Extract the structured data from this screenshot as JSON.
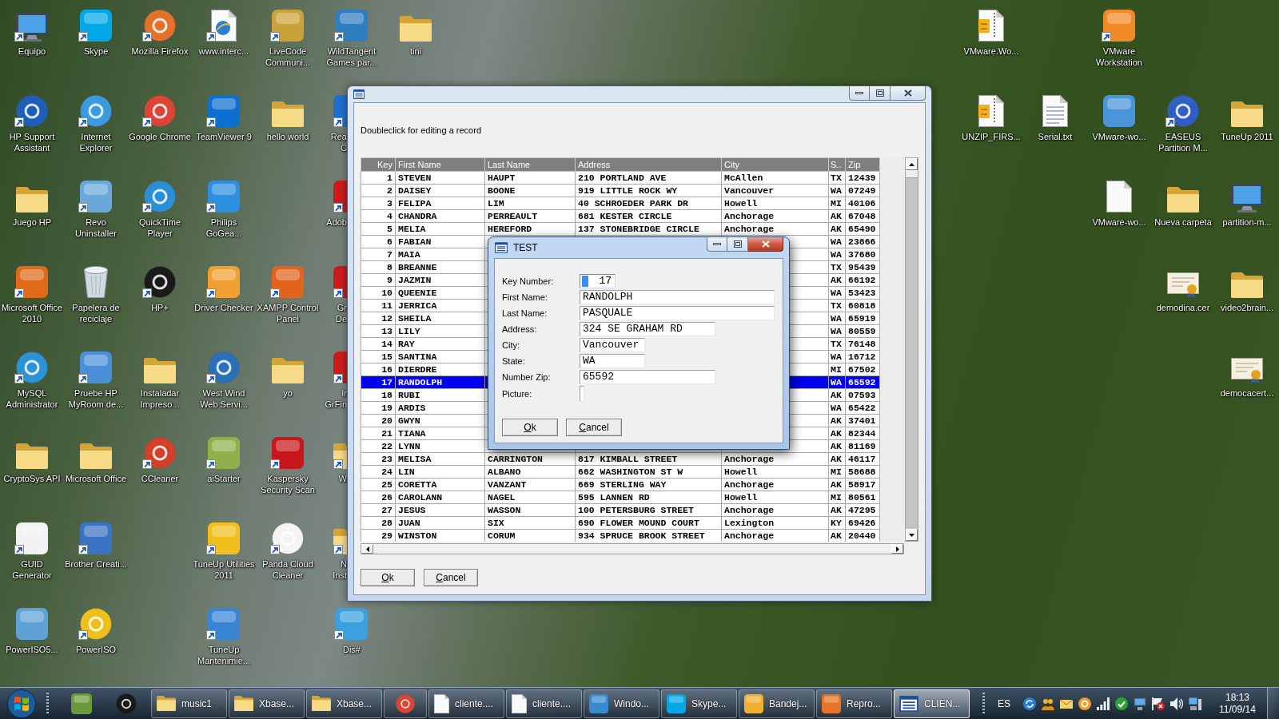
{
  "desktop": {
    "left_icons": [
      [
        {
          "label": "Equipo",
          "kind": "monitor",
          "shortcut": true
        },
        {
          "label": "Skype",
          "kind": "tile",
          "color": "#00a8e6",
          "shortcut": true
        },
        {
          "label": "Mozilla Firefox",
          "kind": "disc",
          "color": "#e5702a",
          "shortcut": true
        },
        {
          "label": "www.interc...",
          "kind": "web",
          "shortcut": true
        },
        {
          "label": "LiveCode Communi...",
          "kind": "tile",
          "color": "#c9a33a",
          "shortcut": true
        },
        {
          "label": "WildTangent Games par...",
          "kind": "tile",
          "color": "#2f7fc0",
          "shortcut": true
        },
        {
          "label": "tini",
          "kind": "folder",
          "shortcut": false
        }
      ],
      [
        {
          "label": "HP Support Assistant",
          "kind": "disc",
          "color": "#1d5fb8",
          "shortcut": true
        },
        {
          "label": "Internet Explorer",
          "kind": "disc",
          "color": "#3b9be0",
          "shortcut": true
        },
        {
          "label": "Google Chrome",
          "kind": "disc",
          "color": "#db4437",
          "shortcut": true
        },
        {
          "label": "TeamViewer 9",
          "kind": "tile",
          "color": "#0d6fd0",
          "shortcut": true
        },
        {
          "label": "hello world",
          "kind": "folder",
          "shortcut": false
        },
        {
          "label": "Rea C",
          "kind": "tile",
          "color": "#1f6fd0",
          "shortcut": true
        }
      ],
      [
        {
          "label": "Juego HP",
          "kind": "folder",
          "shortcut": false
        },
        {
          "label": "Revo Uninstaller",
          "kind": "tile",
          "color": "#6aa8dc",
          "shortcut": true
        },
        {
          "label": "QuickTime Player",
          "kind": "disc",
          "color": "#2b8fd8",
          "shortcut": true
        },
        {
          "label": "Philips GoGea...",
          "kind": "tile",
          "color": "#2c8fe0",
          "shortcut": true
        },
        {
          "label": "Adob",
          "kind": "tile",
          "color": "#cc1a1a",
          "shortcut": true
        }
      ],
      [
        {
          "label": "Microsoft Office 2010",
          "kind": "tile",
          "color": "#e06a1a",
          "shortcut": true
        },
        {
          "label": "Papelera de reciclaje",
          "kind": "recycle",
          "shortcut": false
        },
        {
          "label": "HP+",
          "kind": "disc",
          "color": "#1a1a1a",
          "shortcut": true
        },
        {
          "label": "Driver Checker",
          "kind": "tile",
          "color": "#f0a030",
          "shortcut": true
        },
        {
          "label": "XAMPP Control Panel",
          "kind": "tile",
          "color": "#e2641c",
          "shortcut": true
        },
        {
          "label": "Gr De",
          "kind": "tile",
          "color": "#cc1a1a",
          "shortcut": true
        }
      ],
      [
        {
          "label": "MySQL Administrator",
          "kind": "disc",
          "color": "#2b93d6",
          "shortcut": true
        },
        {
          "label": "Pruebe HP MyRoom de...",
          "kind": "tile",
          "color": "#4a8fd8",
          "shortcut": true
        },
        {
          "label": "Instaladar Impreso...",
          "kind": "folder",
          "shortcut": false
        },
        {
          "label": "West Wind Web Servi...",
          "kind": "disc",
          "color": "#2a6fb8",
          "shortcut": true
        },
        {
          "label": "yo",
          "kind": "folder",
          "shortcut": false
        },
        {
          "label": "Ir GrFin",
          "kind": "tile",
          "color": "#cc1a1a",
          "shortcut": true
        }
      ],
      [
        {
          "label": "CryptoSys API",
          "kind": "folder",
          "shortcut": false
        },
        {
          "label": "Microsoft Office",
          "kind": "folder",
          "shortcut": false
        },
        {
          "label": "CCleaner",
          "kind": "disc",
          "color": "#d2402a",
          "shortcut": true
        },
        {
          "label": "aiStarter",
          "kind": "tile",
          "color": "#8fb04a",
          "shortcut": true
        },
        {
          "label": "Kaspersky Security Scan",
          "kind": "tile",
          "color": "#c8161d",
          "shortcut": true
        },
        {
          "label": "W",
          "kind": "folder",
          "shortcut": true
        }
      ],
      [
        {
          "label": "GUID Generator",
          "kind": "tile",
          "color": "#f2f2f2",
          "shortcut": true
        },
        {
          "label": "Brother Creati...",
          "kind": "tile",
          "color": "#3b73c4",
          "shortcut": true
        },
        {
          "label": "TuneUp Utilities 2011",
          "kind": "tile",
          "color": "#f2c01e",
          "shortcut": true
        },
        {
          "label": "Panda Cloud Cleaner",
          "kind": "disc",
          "color": "#f4f4f4",
          "shortcut": true
        },
        {
          "label": "N Inst",
          "kind": "folder",
          "shortcut": true
        }
      ],
      [
        {
          "label": "PowerISO5...",
          "kind": "tile",
          "color": "#5ea2d6",
          "shortcut": false
        },
        {
          "label": "PowerISO",
          "kind": "disc",
          "color": "#f0c01a",
          "shortcut": true
        },
        {
          "label": "TuneUp Mantenimie...",
          "kind": "tile",
          "color": "#3a84d4",
          "shortcut": true
        },
        {
          "label": "Dis#",
          "kind": "tile",
          "color": "#3aa0e0",
          "shortcut": true
        }
      ]
    ],
    "right_icons": [
      [
        {
          "label": "VMware.Wo...",
          "kind": "zip",
          "shortcut": false
        },
        {
          "label": "VMware Workstation",
          "kind": "tile",
          "color": "#f08a24",
          "shortcut": true
        }
      ],
      [
        {
          "label": "UNZIP_FIRS...",
          "kind": "zip",
          "shortcut": false
        },
        {
          "label": "Serial.txt",
          "kind": "text",
          "shortcut": false
        },
        {
          "label": "VMware-wo...",
          "kind": "tile",
          "color": "#4a94d8",
          "shortcut": false
        },
        {
          "label": "EASEUS Partition M...",
          "kind": "disc",
          "color": "#2f5fc4",
          "shortcut": true
        },
        {
          "label": "TuneUp 2011",
          "kind": "folder",
          "shortcut": false
        }
      ],
      [
        {
          "label": "VMware-wo...",
          "kind": "document",
          "shortcut": false
        },
        {
          "label": "Nueva carpeta",
          "kind": "folder",
          "shortcut": false
        },
        {
          "label": "partition-m...",
          "kind": "monitor",
          "shortcut": false
        }
      ],
      [
        {
          "label": "demodina.cer",
          "kind": "certificate",
          "shortcut": false
        },
        {
          "label": "video2brain...",
          "kind": "folder",
          "shortcut": false
        }
      ],
      [
        {
          "label": "democacert...",
          "kind": "certificate",
          "shortcut": false
        }
      ]
    ]
  },
  "main_window": {
    "hint": "Doubleclick for editing a record",
    "table": {
      "columns": [
        "Key",
        "First Name",
        "Last Name",
        "Address",
        "City",
        "S..",
        "Zip"
      ],
      "rows": [
        {
          "cells": [
            "1",
            "STEVEN",
            "HAUPT",
            "210 PORTLAND AVE",
            "McAllen",
            "TX",
            "12439"
          ],
          "selected": false
        },
        {
          "cells": [
            "2",
            "DAISEY",
            "BOONE",
            "919 LITTLE ROCK WY",
            "Vancouver",
            "WA",
            "07249"
          ],
          "selected": false
        },
        {
          "cells": [
            "3",
            "FELIPA",
            "LIM",
            "40 SCHROEDER PARK DR",
            "Howell",
            "MI",
            "40106"
          ],
          "selected": false
        },
        {
          "cells": [
            "4",
            "CHANDRA",
            "PERREAULT",
            "681 KESTER CIRCLE",
            "Anchorage",
            "AK",
            "67048"
          ],
          "selected": false
        },
        {
          "cells": [
            "5",
            "MELIA",
            "HEREFORD",
            "137 STONEBRIDGE CIRCLE",
            "Anchorage",
            "AK",
            "65490"
          ],
          "selected": false
        },
        {
          "cells": [
            "6",
            "FABIAN",
            null,
            null,
            null,
            "WA",
            "23866"
          ],
          "selected": false
        },
        {
          "cells": [
            "7",
            "MAIA",
            null,
            null,
            null,
            "WA",
            "37680"
          ],
          "selected": false
        },
        {
          "cells": [
            "8",
            "BREANNE",
            null,
            null,
            null,
            "TX",
            "95439"
          ],
          "selected": false
        },
        {
          "cells": [
            "9",
            "JAZMIN",
            null,
            null,
            null,
            "AK",
            "66192"
          ],
          "selected": false
        },
        {
          "cells": [
            "10",
            "QUEENIE",
            null,
            null,
            null,
            "WA",
            "53423"
          ],
          "selected": false
        },
        {
          "cells": [
            "11",
            "JERRICA",
            null,
            null,
            null,
            "TX",
            "60818"
          ],
          "selected": false
        },
        {
          "cells": [
            "12",
            "SHEILA",
            null,
            null,
            null,
            "WA",
            "65919"
          ],
          "selected": false
        },
        {
          "cells": [
            "13",
            "LILY",
            null,
            null,
            null,
            "WA",
            "80559"
          ],
          "selected": false
        },
        {
          "cells": [
            "14",
            "RAY",
            null,
            null,
            null,
            "TX",
            "76148"
          ],
          "selected": false
        },
        {
          "cells": [
            "15",
            "SANTINA",
            null,
            null,
            null,
            "WA",
            "16712"
          ],
          "selected": false
        },
        {
          "cells": [
            "16",
            "DIERDRE",
            null,
            null,
            null,
            "MI",
            "67502"
          ],
          "selected": false
        },
        {
          "cells": [
            "17",
            "RANDOLPH",
            null,
            null,
            null,
            "WA",
            "65592"
          ],
          "selected": true
        },
        {
          "cells": [
            "18",
            "RUBI",
            null,
            null,
            null,
            "AK",
            "07593"
          ],
          "selected": false
        },
        {
          "cells": [
            "19",
            "ARDIS",
            null,
            null,
            null,
            "WA",
            "65422"
          ],
          "selected": false
        },
        {
          "cells": [
            "20",
            "GWYN",
            null,
            null,
            null,
            "AK",
            "37401"
          ],
          "selected": false
        },
        {
          "cells": [
            "21",
            "TIANA",
            null,
            null,
            null,
            "AK",
            "82344"
          ],
          "selected": false
        },
        {
          "cells": [
            "22",
            "LYNN",
            null,
            null,
            null,
            "AK",
            "81169"
          ],
          "selected": false
        },
        {
          "cells": [
            "23",
            "MELISA",
            "CARRINGTON",
            "817 KIMBALL STREET",
            "Anchorage",
            "AK",
            "46117"
          ],
          "selected": false
        },
        {
          "cells": [
            "24",
            "LIN",
            "ALBANO",
            "662 WASHINGTON ST W",
            "Howell",
            "MI",
            "58688"
          ],
          "selected": false
        },
        {
          "cells": [
            "25",
            "CORETTA",
            "VANZANT",
            "669 STERLING WAY",
            "Anchorage",
            "AK",
            "58917"
          ],
          "selected": false
        },
        {
          "cells": [
            "26",
            "CAROLANN",
            "NAGEL",
            "595 LANNEN RD",
            "Howell",
            "MI",
            "80561"
          ],
          "selected": false
        },
        {
          "cells": [
            "27",
            "JESUS",
            "WASSON",
            "100 PETERSBURG STREET",
            "Anchorage",
            "AK",
            "47295"
          ],
          "selected": false
        },
        {
          "cells": [
            "28",
            "JUAN",
            "SIX",
            "690 FLOWER MOUND COURT",
            "Lexington",
            "KY",
            "69426"
          ],
          "selected": false
        },
        {
          "cells": [
            "29",
            "WINSTON",
            "CORUM",
            "934 SPRUCE BROOK STREET",
            "Anchorage",
            "AK",
            "20440"
          ],
          "selected": false
        }
      ]
    },
    "buttons": [
      {
        "label": "Ok",
        "access_key_underlined": true
      },
      {
        "label": "Cancel",
        "access_key_underlined": true
      }
    ]
  },
  "dialog": {
    "title": "TEST",
    "fields": [
      {
        "label": "Key Number:",
        "value": "17",
        "focused": true
      },
      {
        "label": "First Name:",
        "value": "RANDOLPH",
        "focused": false
      },
      {
        "label": "Last Name:",
        "value": "PASQUALE",
        "focused": false
      },
      {
        "label": "Address:",
        "value": "324 SE GRAHAM RD",
        "focused": false
      },
      {
        "label": "City:",
        "value": "Vancouver",
        "focused": false
      },
      {
        "label": "State:",
        "value": "WA",
        "focused": false
      },
      {
        "label": "Number Zip:",
        "value": "65592",
        "focused": false
      },
      {
        "label": "Picture:",
        "focused": false
      }
    ],
    "buttons": [
      {
        "label": "Ok",
        "access_key_underlined": true
      },
      {
        "label": "Cancel",
        "access_key_underlined": true
      }
    ]
  },
  "taskbar": {
    "quick_launch": [
      {
        "kind": "tile",
        "color": "#6a9a3a"
      },
      {
        "kind": "disc",
        "color": "#1a1a1a"
      }
    ],
    "buttons": [
      {
        "label": "music1",
        "kind": "folder",
        "selected": false
      },
      {
        "label": "Xbase...",
        "kind": "folder",
        "selected": false
      },
      {
        "label": "Xbase...",
        "kind": "folder",
        "selected": false
      },
      {
        "kind": "disc",
        "color": "#db4437",
        "selected": false
      },
      {
        "label": "cliente....",
        "kind": "document",
        "selected": false
      },
      {
        "label": "cliente....",
        "kind": "document",
        "selected": false
      },
      {
        "label": "Windo...",
        "kind": "tile",
        "color": "#3a8ad0",
        "selected": false
      },
      {
        "label": "Skype...",
        "kind": "tile",
        "color": "#00a8e6",
        "selected": false
      },
      {
        "label": "Bandej...",
        "kind": "tile",
        "color": "#f0b030",
        "selected": false
      },
      {
        "label": "Repro...",
        "kind": "tile",
        "color": "#e8742a",
        "selected": false
      },
      {
        "label": "CLIEN...",
        "kind": "window",
        "selected": true
      }
    ],
    "language": "ES",
    "clock": {
      "time": "18:13",
      "date": "11/09/14"
    }
  }
}
